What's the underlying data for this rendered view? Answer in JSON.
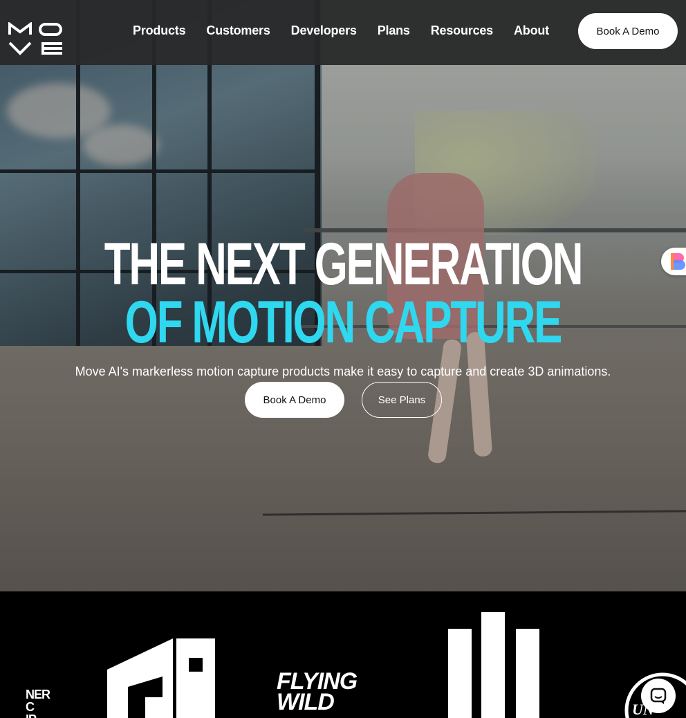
{
  "nav": {
    "logo_alt": "MOVE",
    "items": [
      {
        "label": "Products"
      },
      {
        "label": "Customers"
      },
      {
        "label": "Developers"
      },
      {
        "label": "Plans"
      },
      {
        "label": "Resources"
      },
      {
        "label": "About"
      }
    ],
    "cta_label": "Book A Demo"
  },
  "hero": {
    "headline_line1": "THE NEXT GENERATION",
    "headline_line2": "OF MOTION CAPTURE",
    "subtitle": "Move AI's markerless motion capture products make it easy to capture and create 3D animations.",
    "primary_button": "Book A Demo",
    "secondary_button": "See Plans",
    "accent_color": "#2fd7ef"
  },
  "customer_logos": {
    "partial_logo_text": [
      "NER",
      "C",
      "IP"
    ],
    "flying_wild_text": [
      "FLYING",
      "WILD"
    ],
    "partial_right_text": "UN"
  },
  "icons": {
    "chat": "chat-bubble-icon",
    "side_widget": "bookmark-widget-icon"
  }
}
